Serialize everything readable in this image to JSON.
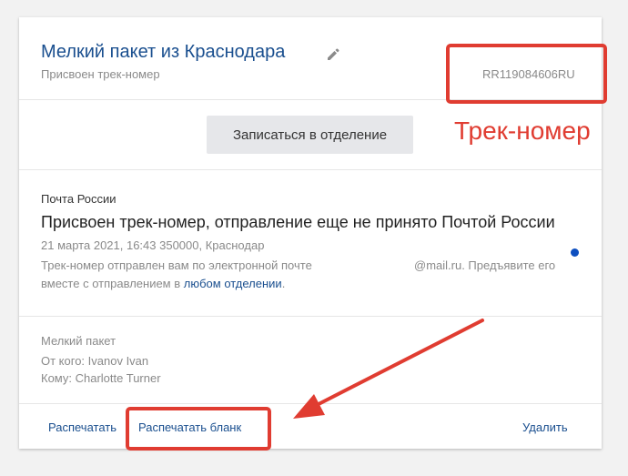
{
  "parcel": {
    "title": "Мелкий пакет из Краснодара",
    "subtitle": "Присвоен трек-номер",
    "track_number": "RR119084606RU"
  },
  "enroll_button_label": "Записаться в отделение",
  "status": {
    "carrier": "Почта России",
    "title": "Присвоен трек-номер, отправление еще не принято Почтой России",
    "meta": "21 марта 2021, 16:43 350000, Краснодар",
    "note_part1": "Трек-номер отправлен вам по электронной почте",
    "note_email": "@mail.ru. Предъявите его",
    "note_part2": "вместе с отправлением в",
    "note_link": "любом отделении",
    "note_end": "."
  },
  "details": {
    "type": "Мелкий пакет",
    "from": "От кого: Ivanov Ivan",
    "to": "Кому: Charlotte Turner"
  },
  "actions": {
    "print": "Распечатать",
    "print_form": "Распечатать бланк",
    "delete": "Удалить"
  },
  "annotation": {
    "label": "Трек-номер",
    "color": "#e03c31"
  },
  "colors": {
    "accent_blue": "#1a4f8f",
    "status_dot": "#0d4fc0"
  }
}
